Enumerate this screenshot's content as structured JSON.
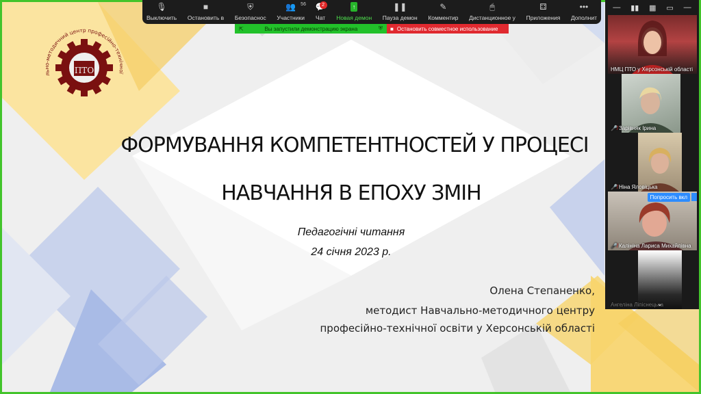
{
  "toolbar": {
    "items": [
      {
        "label": "Выключить",
        "icon": "mic-icon",
        "glyph": "🎙"
      },
      {
        "label": "Остановить в",
        "icon": "video-icon",
        "glyph": "■"
      },
      {
        "label": "Безопаснос",
        "icon": "shield-icon",
        "glyph": "⛨"
      },
      {
        "label": "Участники",
        "icon": "participants-icon",
        "glyph": "👥",
        "count": "56"
      },
      {
        "label": "Чат",
        "icon": "chat-icon",
        "glyph": "💬",
        "badge": "2"
      },
      {
        "label": "Новая демон",
        "icon": "share-screen-icon",
        "glyph": "↑"
      },
      {
        "label": "Пауза демон",
        "icon": "pause-icon",
        "glyph": "❚❚"
      },
      {
        "label": "Комментир",
        "icon": "annotate-icon",
        "glyph": "✎"
      },
      {
        "label": "Дистанционное у",
        "icon": "remote-control-icon",
        "glyph": "🖱"
      },
      {
        "label": "Приложения",
        "icon": "apps-icon",
        "glyph": "⚃"
      },
      {
        "label": "Дополнит",
        "icon": "more-icon",
        "glyph": "•••"
      }
    ]
  },
  "share_bar": {
    "message": "Вы запустили демонстрацию экрана",
    "stop_label": "Остановить совместное использование"
  },
  "slide": {
    "title_line1": "ФОРМУВАННЯ КОМПЕТЕНТНОСТЕЙ У ПРОЦЕСІ",
    "title_line2": "НАВЧАННЯ В ЕПОХУ ЗМІН",
    "event": "Педагогічні читання",
    "date": "24 січня 2023 р.",
    "author_line1": "Олена Степаненко,",
    "author_line2": "методист Навчально-методичного центру",
    "author_line3": "професійно-технічної освіти у Херсонській області",
    "logo_text": "Навчально-методичний центр професійно-технічної освіти",
    "logo_mark": "ПТО"
  },
  "panel": {
    "top_icons": [
      "—",
      "▮▮",
      "▦",
      "▭",
      "—"
    ],
    "participants": [
      {
        "name": "НМЦ ПТО у Херсонській області",
        "muted": false
      },
      {
        "name": "Зарівняк Ірина",
        "muted": true
      },
      {
        "name": "Ніна Яловіцька",
        "muted": true
      },
      {
        "name": "Калініна Лариса Михайлівна",
        "muted": true,
        "ask_button": "Попросить вкл"
      },
      {
        "name": "Ангеліна Ліпіснецька",
        "muted": false
      }
    ],
    "expand_icon": "chevron-down-icon"
  },
  "colors": {
    "accent_green": "#43c42b",
    "logo_red": "#7a1010",
    "deco_yellow": "#f8d46a",
    "deco_blue": "#a8bce6"
  }
}
